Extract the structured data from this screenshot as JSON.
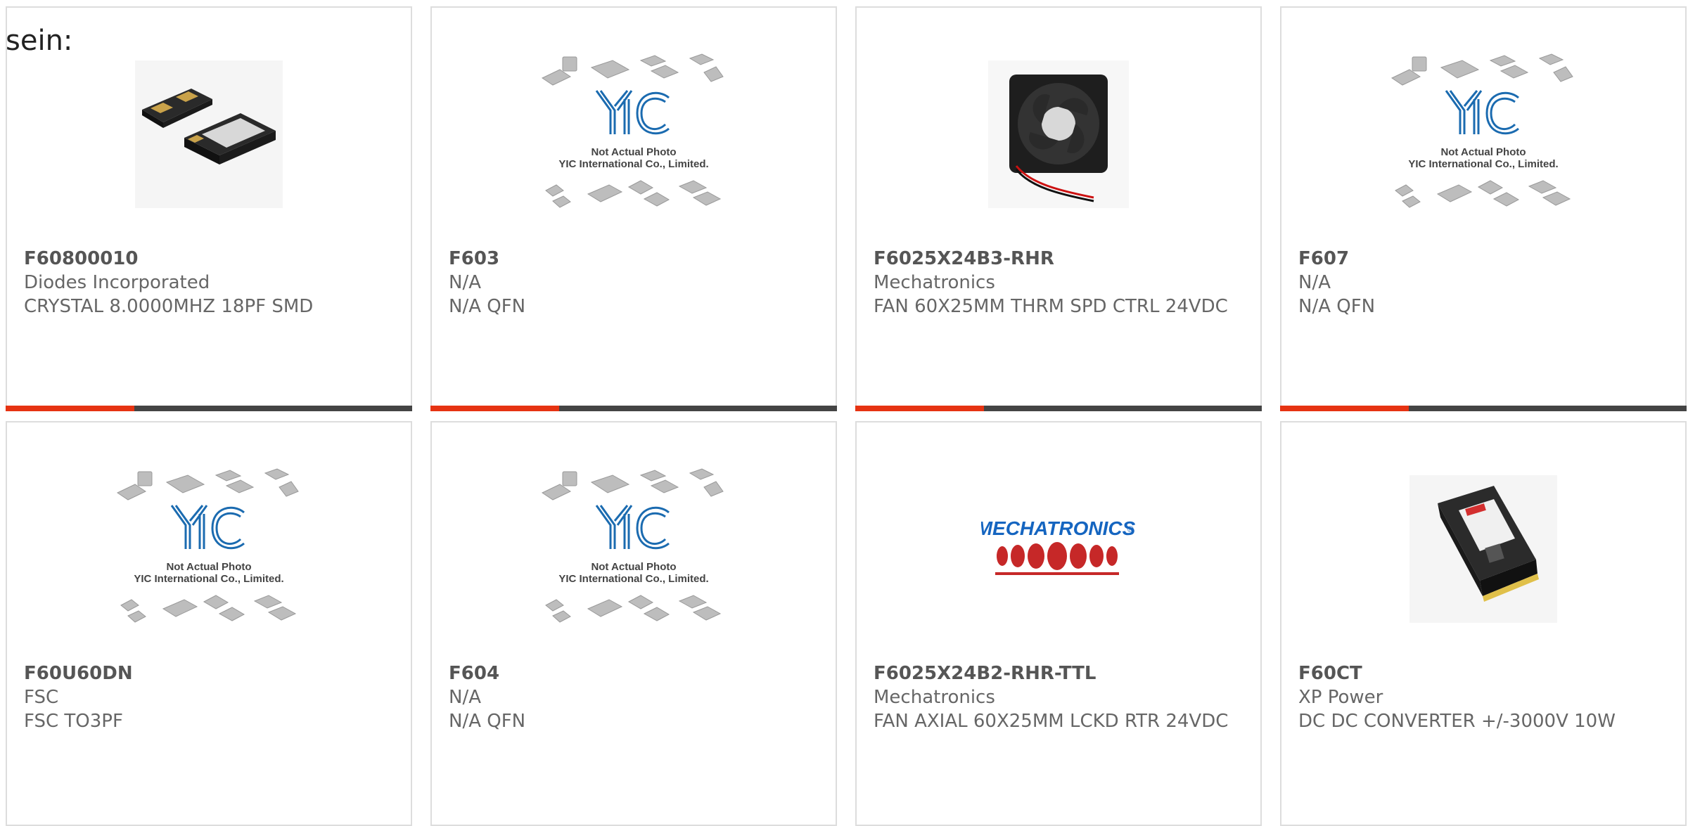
{
  "top_label": "sein:",
  "colors": {
    "accent": "#e63312",
    "bar_dark": "#444444",
    "border": "#dddddd",
    "text": "#666666"
  },
  "placeholder_caption": {
    "line1": "Not Actual Photo",
    "line2": "YIC International Co., Limited."
  },
  "products": [
    {
      "part": "F60800010",
      "manufacturer": "Diodes Incorporated",
      "description": "CRYSTAL 8.0000MHZ 18PF SMD",
      "image": "crystal-smd-photo"
    },
    {
      "part": "F603",
      "manufacturer": "N/A",
      "description": "N/A QFN",
      "image": "yic-placeholder"
    },
    {
      "part": "F6025X24B3-RHR",
      "manufacturer": "Mechatronics",
      "description": "FAN 60X25MM THRM SPD CTRL 24VDC",
      "image": "fan-photo"
    },
    {
      "part": "F607",
      "manufacturer": "N/A",
      "description": "N/A QFN",
      "image": "yic-placeholder"
    },
    {
      "part": "F60U60DN",
      "manufacturer": "FSC",
      "description": "FSC TO3PF",
      "image": "yic-placeholder"
    },
    {
      "part": "F604",
      "manufacturer": "N/A",
      "description": "N/A QFN",
      "image": "yic-placeholder"
    },
    {
      "part": "F6025X24B2-RHR-TTL",
      "manufacturer": "Mechatronics",
      "description": "FAN AXIAL 60X25MM LCKD RTR 24VDC",
      "image": "mechatronics-logo",
      "logo_text": "MECHATRONICS"
    },
    {
      "part": "F60CT",
      "manufacturer": "XP Power",
      "description": "DC DC CONVERTER +/-3000V 10W",
      "image": "dc-converter-photo"
    }
  ]
}
